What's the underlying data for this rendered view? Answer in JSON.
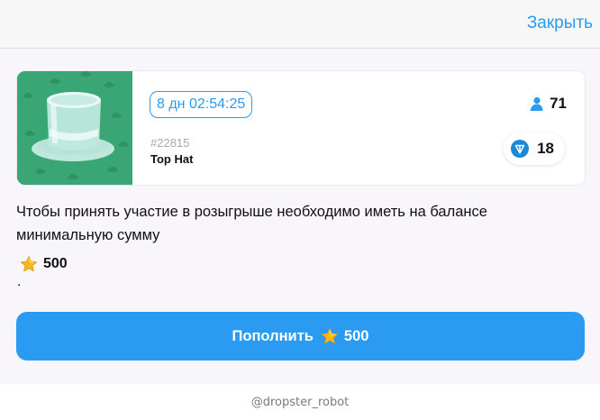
{
  "header": {
    "close_label": "Закрыть"
  },
  "lot": {
    "timer": "8 дн 02:54:25",
    "id": "#22815",
    "name": "Top Hat",
    "participants": "71",
    "ton_price": "18",
    "image_icon": "top-hat-icon",
    "accent": "#2a9bf0",
    "image_bg": "#3aa676"
  },
  "message": {
    "text": "Чтобы принять участие в розыгрыше необходимо иметь на балансе минимальную сумму",
    "min_amount": "500",
    "trailing": "."
  },
  "topup": {
    "label": "Пополнить",
    "amount": "500"
  },
  "footer": {
    "bot_name": "@dropster_robot"
  }
}
